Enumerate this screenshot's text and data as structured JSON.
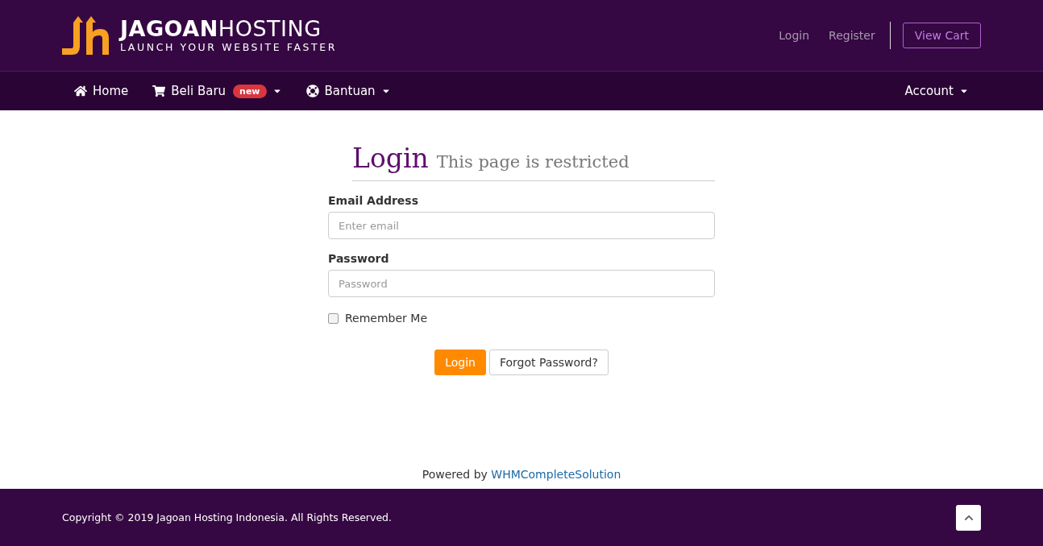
{
  "brand": {
    "name": "**JAGOAN**HOSTING",
    "tagline": "LAUNCH YOUR WEBSITE FASTER"
  },
  "top_links": [
    {
      "label": "Login"
    },
    {
      "label": "Register"
    }
  ],
  "cart_button": "View Cart",
  "nav": [
    {
      "kind": "home",
      "label": "Home",
      "dropdown": false
    },
    {
      "kind": "cart",
      "label": "Beli Baru",
      "badge": "new",
      "dropdown": true
    },
    {
      "kind": "help",
      "label": "Bantuan",
      "dropdown": true
    }
  ],
  "account_menu": {
    "label": "Account",
    "dropdown": true
  },
  "page": {
    "title": "Login",
    "subtitle": "This page is restricted"
  },
  "form": {
    "fields": [
      {
        "label": "Email Address",
        "placeholder": "Enter email"
      },
      {
        "label": "Password",
        "placeholder": "Password"
      }
    ],
    "remember": {
      "label": "Remember Me",
      "checked": false
    },
    "buttons": [
      {
        "kind": "primary",
        "label": "Login"
      },
      {
        "kind": "default",
        "label": "Forgot Password?"
      }
    ]
  },
  "powered": {
    "text": "Powered by",
    "link": "WHMCompleteSolution"
  },
  "footer": {
    "copyright": "Copyright © 2019 Jagoan Hosting Indonesia. All Rights Reserved."
  }
}
